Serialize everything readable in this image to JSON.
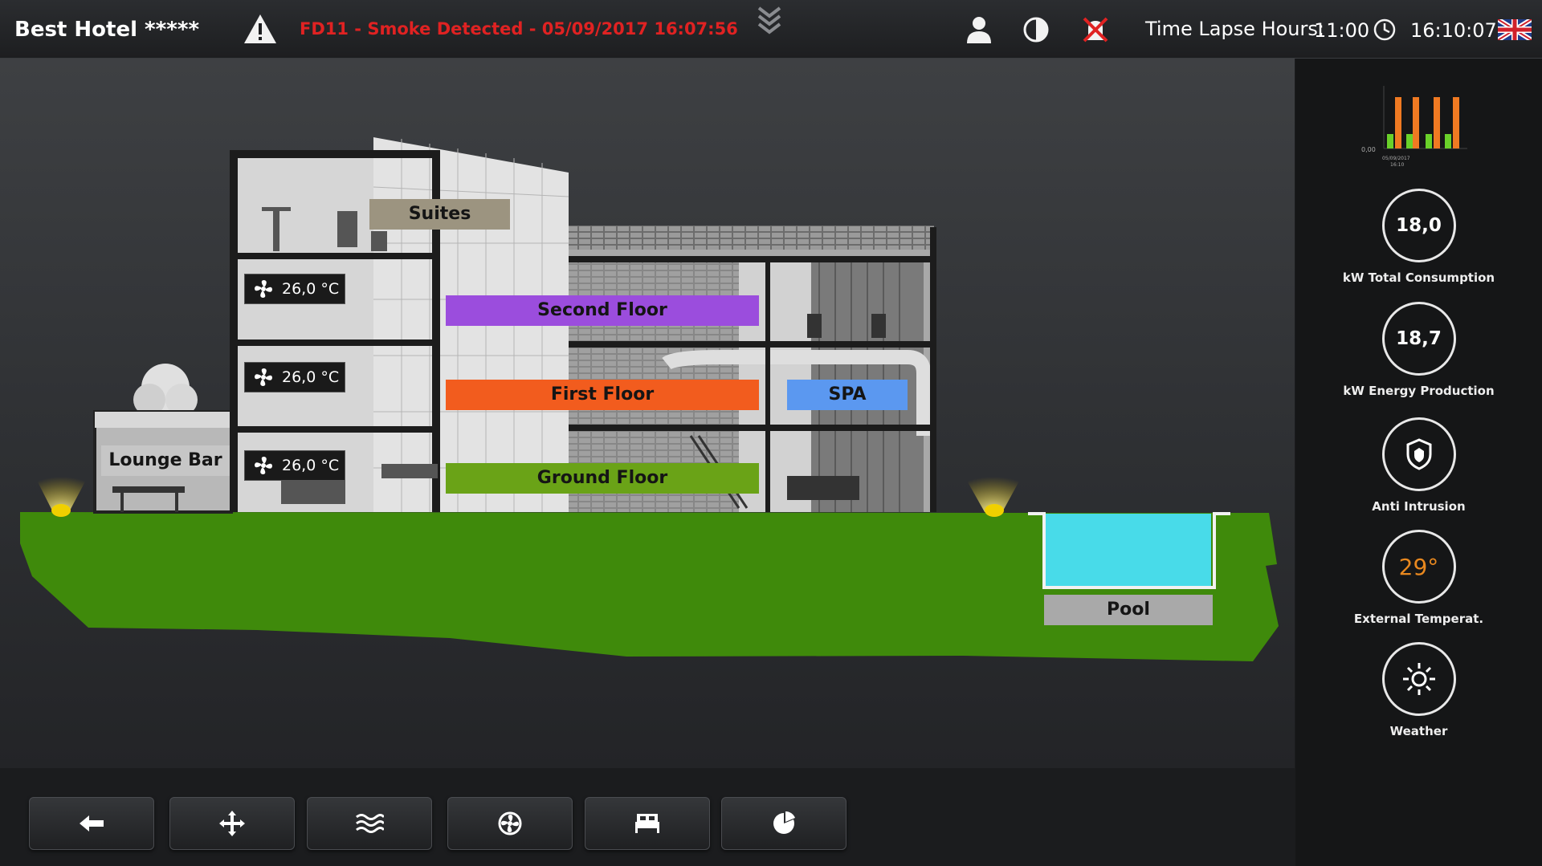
{
  "header": {
    "title": "Best Hotel *****",
    "alarm_message": "FD11 - Smoke Detected - 05/09/2017 16:07:56",
    "time_lapse_label": "Time Lapse Hours:",
    "time_lapse_value": "11:00",
    "clock_value": "16:10:07",
    "icons": [
      "warning-icon",
      "chevron-double-down-icon",
      "user-icon",
      "contrast-icon",
      "alarm-mute-icon",
      "clock-icon",
      "uk-flag-icon"
    ]
  },
  "scene": {
    "floors": [
      {
        "label": "Suites",
        "color": "#9c9480"
      },
      {
        "label": "Second Floor",
        "color": "#9b4ddd"
      },
      {
        "label": "First Floor",
        "color": "#f25c1e"
      },
      {
        "label": "Ground Floor",
        "color": "#6aa317"
      },
      {
        "label": "SPA",
        "color": "#5b98f0"
      },
      {
        "label": "Lounge Bar",
        "color": "#c6c6c6"
      },
      {
        "label": "Pool",
        "color": "#a9a9a9"
      }
    ],
    "temperatures": [
      "26,0 °C",
      "26,0 °C",
      "26,0 °C"
    ],
    "ground_color": "#3f8a0b",
    "pool_color": "#48dbe9"
  },
  "sidebar": {
    "mini_chart": {
      "y_tick": "0,00",
      "x_tick_date": "05/09/2017",
      "x_tick_time": "16:10",
      "series_colors": [
        "#f07a22",
        "#6ad12a"
      ]
    },
    "widgets": [
      {
        "value": "18,0",
        "label": "kW Total Consumption"
      },
      {
        "value": "18,7",
        "label": "kW Energy Production"
      },
      {
        "value": "",
        "label": "Anti Intrusion",
        "icon": "shield-icon"
      },
      {
        "value": "29°",
        "label": "External Temperat.",
        "value_color": "#e8881f"
      },
      {
        "value": "",
        "label": "Weather",
        "icon": "sun-icon"
      }
    ]
  },
  "toolbar": {
    "buttons": [
      {
        "name": "back-button",
        "icon": "arrow-left-icon"
      },
      {
        "name": "move-button",
        "icon": "move-arrows-icon"
      },
      {
        "name": "ventilation-button",
        "icon": "waves-icon"
      },
      {
        "name": "fan-button",
        "icon": "fan-icon"
      },
      {
        "name": "rooms-button",
        "icon": "bed-icon"
      },
      {
        "name": "energy-button",
        "icon": "pie-chart-icon"
      }
    ]
  }
}
